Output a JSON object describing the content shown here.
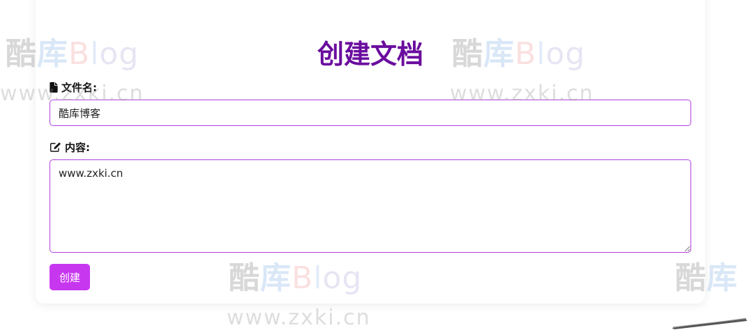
{
  "page": {
    "title": "创建文档"
  },
  "form": {
    "filename_label": "文件名:",
    "filename_value": "酷库博客",
    "content_label": "内容:",
    "content_value": "www.zxki.cn",
    "submit_label": "创建"
  },
  "icons": {
    "filename": "file-icon",
    "content": "edit-icon"
  },
  "colors": {
    "title": "#6a0d9e",
    "input_border": "#b040e0",
    "button": "#c837f0"
  },
  "watermark": {
    "logo_char1": "酷",
    "logo_char2": "库",
    "logo_b": "B",
    "logo_l": "l",
    "logo_og": "og",
    "url": "www.zxki.cn"
  }
}
